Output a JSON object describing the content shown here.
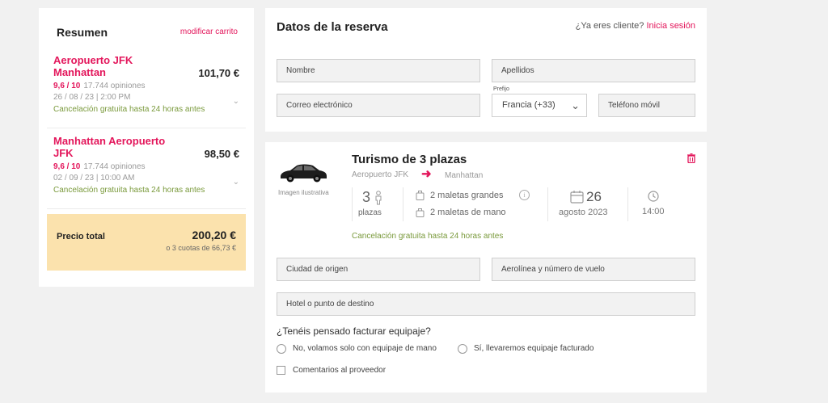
{
  "summary": {
    "title": "Resumen",
    "modify_label": "modificar carrito",
    "trips": [
      {
        "route": "Aeropuerto JFK Manhattan",
        "price": "101,70 €",
        "rating": "9,6 / 10",
        "reviews": "17.744 opiniones",
        "datetime": "26 / 08 / 23  |  2:00 PM",
        "cancellation": "Cancelación gratuita hasta 24 horas antes"
      },
      {
        "route": "Manhattan Aeropuerto JFK",
        "price": "98,50 €",
        "rating": "9,6 / 10",
        "reviews": "17.744 opiniones",
        "datetime": "02 / 09 / 23  |  10:00 AM",
        "cancellation": "Cancelación gratuita hasta 24 horas antes"
      }
    ],
    "total_label": "Precio total",
    "total_price": "200,20 €",
    "installments": "o 3 cuotas de 66,73 €"
  },
  "details": {
    "title": "Datos de la reserva",
    "login_prompt": "¿Ya eres cliente?",
    "login_link": "Inicia sesión",
    "fields": {
      "nombre": "Nombre",
      "apellidos": "Apellidos",
      "correo": "Correo electrónico",
      "prefijo_label": "Prefijo",
      "prefijo_value": "Francia (+33)",
      "telefono": "Teléfono móvil"
    }
  },
  "transfer": {
    "vehicle": "Turismo de 3 plazas",
    "image_caption": "Imagen ilustrativa",
    "from": "Aeropuerto JFK",
    "to": "Manhattan",
    "seats_number": "3",
    "seats_label": "plazas",
    "bags_large": "2 maletas grandes",
    "bags_hand": "2 maletas de mano",
    "day": "26",
    "month_year": "agosto 2023",
    "time": "14:00",
    "free_cancellation": "Cancelación gratuita hasta 24 horas antes",
    "fields": {
      "ciudad": "Ciudad de origen",
      "aerolinea": "Aerolínea y número de vuelo",
      "hotel": "Hotel o punto de destino"
    },
    "luggage_question": "¿Tenéis pensado facturar equipaje?",
    "option_no": "No, volamos solo con equipaje de mano",
    "option_yes": "Sí, llevaremos equipaje facturado",
    "comments_label": "Comentarios al proveedor"
  },
  "colors": {
    "accent": "#e3165b",
    "green": "#7a9a3c",
    "total_bg": "#fbe2ad"
  }
}
